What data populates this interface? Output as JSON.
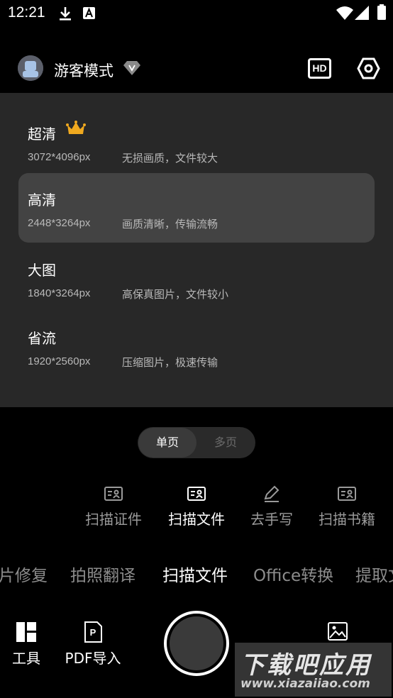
{
  "status_bar": {
    "time": "12:21"
  },
  "header": {
    "user_name": "游客模式",
    "vip_badge": "V",
    "hd_label": "HD"
  },
  "quality_options": [
    {
      "title": "超清",
      "resolution": "3072*4096px",
      "description": "无损画质，文件较大",
      "premium": true,
      "selected": false
    },
    {
      "title": "高清",
      "resolution": "2448*3264px",
      "description": "画质清晰，传输流畅",
      "premium": false,
      "selected": true
    },
    {
      "title": "大图",
      "resolution": "1840*3264px",
      "description": "高保真图片，文件较小",
      "premium": false,
      "selected": false
    },
    {
      "title": "省流",
      "resolution": "1920*2560px",
      "description": "压缩图片，极速传输",
      "premium": false,
      "selected": false
    }
  ],
  "page_toggle": {
    "single": "单页",
    "multi": "多页",
    "selected": "single"
  },
  "scan_modes": [
    {
      "label": "扫描证件",
      "icon": "id-card-icon",
      "active": false
    },
    {
      "label": "扫描文件",
      "icon": "document-scan-icon",
      "active": true
    },
    {
      "label": "去手写",
      "icon": "pen-icon",
      "active": false
    },
    {
      "label": "扫描书籍",
      "icon": "book-scan-icon",
      "active": false
    }
  ],
  "categories": [
    {
      "label": "片修复",
      "active": false
    },
    {
      "label": "拍照翻译",
      "active": false
    },
    {
      "label": "扫描文件",
      "active": true
    },
    {
      "label": "Office转换",
      "active": false
    },
    {
      "label": "提取文",
      "active": false
    }
  ],
  "bottom_bar": {
    "tools_label": "工具",
    "pdf_import_label": "PDF导入",
    "pdf_icon_letter": "P"
  },
  "watermark": {
    "text": "下载吧应用",
    "url": "www.xiazaiiao.com"
  }
}
